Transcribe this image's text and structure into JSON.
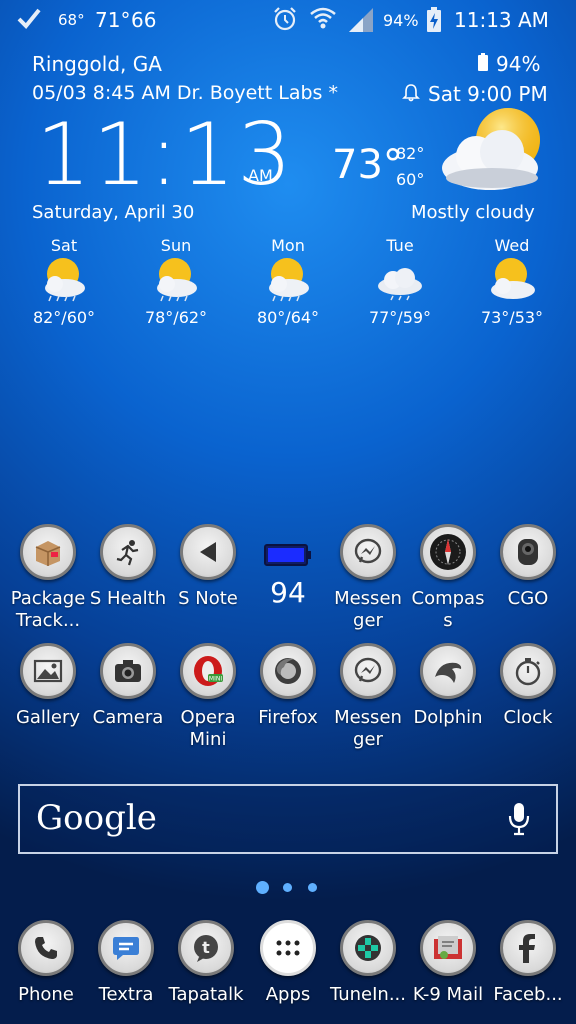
{
  "status_bar": {
    "temp1": "68°",
    "temp2": "71°",
    "count": "66",
    "battery_percent": "94%",
    "time": "11:13 AM"
  },
  "widget": {
    "location": "Ringgold, GA",
    "event": "05/03 8:45 AM Dr. Boyett Labs *",
    "battery": "94%",
    "alarm": "Sat 9:00 PM",
    "clock_time": "11:13",
    "clock_ampm": "AM",
    "date": "Saturday, April 30",
    "current_temp": "73°",
    "high": "82°",
    "low": "60°",
    "condition": "Mostly cloudy",
    "forecast": [
      {
        "day": "Sat",
        "temps": "82°/60°",
        "icon": "partly-cloudy-rain-icon"
      },
      {
        "day": "Sun",
        "temps": "78°/62°",
        "icon": "partly-cloudy-rain-icon"
      },
      {
        "day": "Mon",
        "temps": "80°/64°",
        "icon": "partly-cloudy-rain-icon"
      },
      {
        "day": "Tue",
        "temps": "77°/59°",
        "icon": "cloud-rain-icon"
      },
      {
        "day": "Wed",
        "temps": "73°/53°",
        "icon": "partly-cloudy-icon"
      }
    ]
  },
  "battery_widget": {
    "value": "94"
  },
  "apps": {
    "row1": [
      {
        "label": "Package\nTrack...",
        "icon": "package-icon"
      },
      {
        "label": "S Health",
        "icon": "running-person-icon"
      },
      {
        "label": "S Note",
        "icon": "pen-arrow-icon"
      },
      {
        "label": "Messen\nger",
        "icon": "messenger-icon"
      },
      {
        "label": "Compas\ns",
        "icon": "compass-icon"
      },
      {
        "label": "CGO",
        "icon": "camera-lens-icon"
      }
    ],
    "row2": [
      {
        "label": "Gallery",
        "icon": "gallery-icon"
      },
      {
        "label": "Camera",
        "icon": "camera-icon"
      },
      {
        "label": "Opera\nMini",
        "icon": "opera-mini-icon"
      },
      {
        "label": "Firefox",
        "icon": "firefox-icon"
      },
      {
        "label": "Messen\nger",
        "icon": "messenger-icon"
      },
      {
        "label": "Dolphin",
        "icon": "dolphin-icon"
      },
      {
        "label": "Clock",
        "icon": "stopwatch-icon"
      }
    ]
  },
  "search": {
    "logo": "Google",
    "mic_icon": "microphone-icon"
  },
  "page_indicator": {
    "pages": 3,
    "active": 0
  },
  "dock": [
    {
      "label": "Phone",
      "icon": "phone-icon"
    },
    {
      "label": "Textra",
      "icon": "chat-bubble-icon"
    },
    {
      "label": "Tapatalk",
      "icon": "tapatalk-icon"
    },
    {
      "label": "Apps",
      "icon": "apps-grid-icon"
    },
    {
      "label": "TuneIn...",
      "icon": "tunein-icon"
    },
    {
      "label": "K-9 Mail",
      "icon": "k9-mail-icon"
    },
    {
      "label": "Faceb...",
      "icon": "facebook-icon"
    }
  ],
  "colors": {
    "sun": "#f6c11d",
    "accent_dot": "#5fb0ff",
    "battery": "#1b2cff"
  }
}
